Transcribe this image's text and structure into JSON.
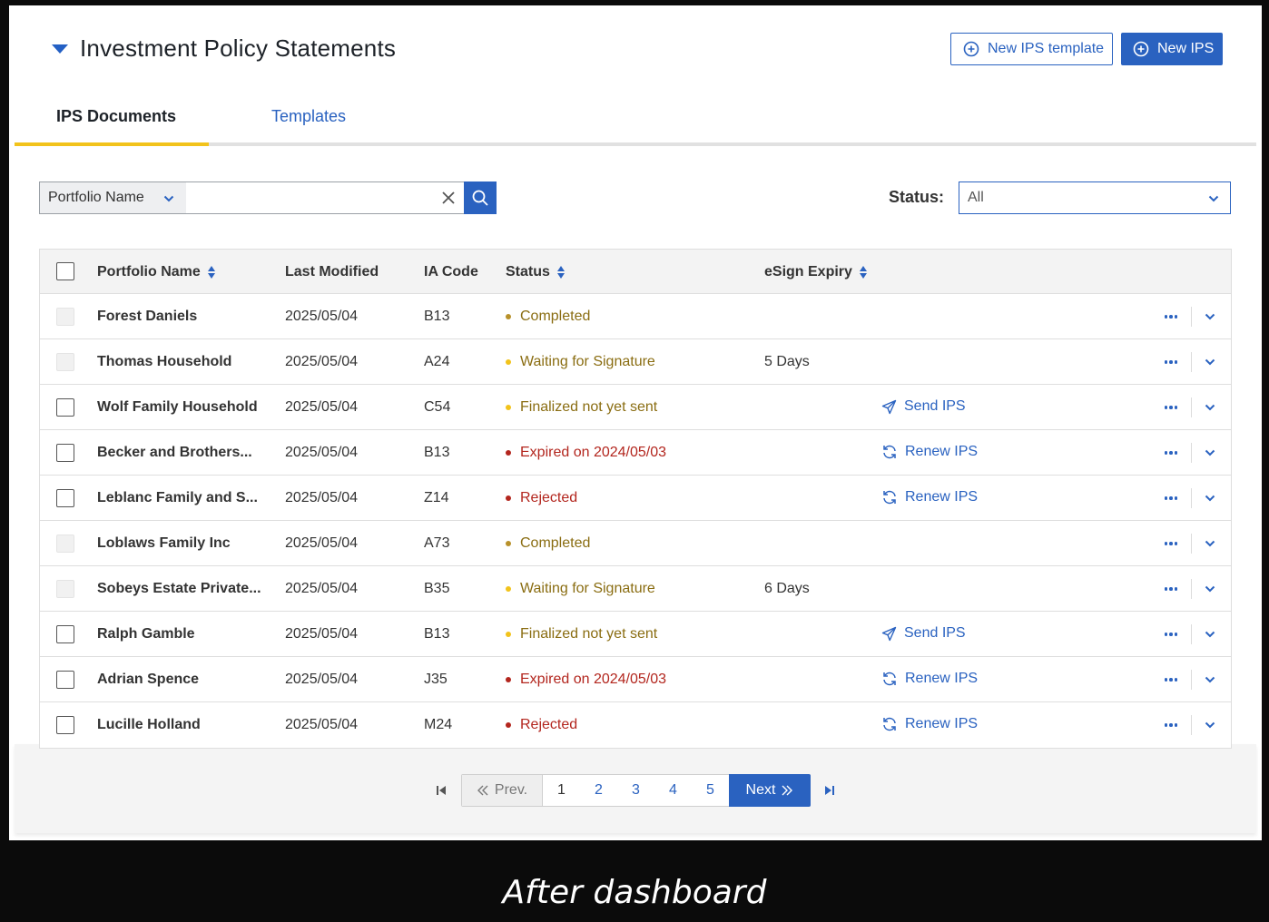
{
  "header": {
    "title": "Investment Policy Statements",
    "new_template_label": "New IPS template",
    "new_ips_label": "New IPS"
  },
  "tabs": [
    {
      "label": "IPS Documents",
      "active": true
    },
    {
      "label": "Templates",
      "active": false
    }
  ],
  "search": {
    "field_label": "Portfolio Name",
    "value": "",
    "placeholder": ""
  },
  "status_filter": {
    "label": "Status:",
    "value": "All"
  },
  "table": {
    "columns": [
      "Portfolio Name",
      "Last Modified",
      "IA Code",
      "Status",
      "eSign Expiry"
    ],
    "rows": [
      {
        "name": "Forest Daniels",
        "modified": "2025/05/04",
        "code": "B13",
        "status": "Completed",
        "expiry": "",
        "action": ""
      },
      {
        "name": "Thomas Household",
        "modified": "2025/05/04",
        "code": "A24",
        "status": "Waiting for Signature",
        "expiry": "5 Days",
        "action": ""
      },
      {
        "name": "Wolf Family Household",
        "modified": "2025/05/04",
        "code": "C54",
        "status": "Finalized not yet sent",
        "expiry": "",
        "action": "Send IPS"
      },
      {
        "name": "Becker and Brothers...",
        "modified": "2025/05/04",
        "code": "B13",
        "status": "Expired on 2024/05/03",
        "expiry": "",
        "action": "Renew IPS"
      },
      {
        "name": "Leblanc Family and S...",
        "modified": "2025/05/04",
        "code": "Z14",
        "status": "Rejected",
        "expiry": "",
        "action": "Renew IPS"
      },
      {
        "name": "Loblaws Family Inc",
        "modified": "2025/05/04",
        "code": "A73",
        "status": "Completed",
        "expiry": "",
        "action": ""
      },
      {
        "name": "Sobeys Estate Private...",
        "modified": "2025/05/04",
        "code": "B35",
        "status": "Waiting for Signature",
        "expiry": "6 Days",
        "action": ""
      },
      {
        "name": "Ralph Gamble",
        "modified": "2025/05/04",
        "code": "B13",
        "status": "Finalized not yet sent",
        "expiry": "",
        "action": "Send IPS"
      },
      {
        "name": "Adrian Spence",
        "modified": "2025/05/04",
        "code": "J35",
        "status": "Expired on 2024/05/03",
        "expiry": "",
        "action": "Renew IPS"
      },
      {
        "name": "Lucille Holland",
        "modified": "2025/05/04",
        "code": "M24",
        "status": "Rejected",
        "expiry": "",
        "action": "Renew IPS"
      }
    ]
  },
  "pagination": {
    "prev_label": "Prev.",
    "next_label": "Next",
    "pages": [
      "1",
      "2",
      "3",
      "4",
      "5"
    ]
  },
  "caption": "After dashboard",
  "colors": {
    "accent": "#2a62c0",
    "tab_underline": "#f2c31b",
    "status_completed": "#8a6d12",
    "status_waiting": "#8a6d12",
    "status_expired": "#b3261e",
    "dot_completed": "#b8912a",
    "dot_waiting": "#f2c31b",
    "dot_expired": "#b3261e"
  }
}
